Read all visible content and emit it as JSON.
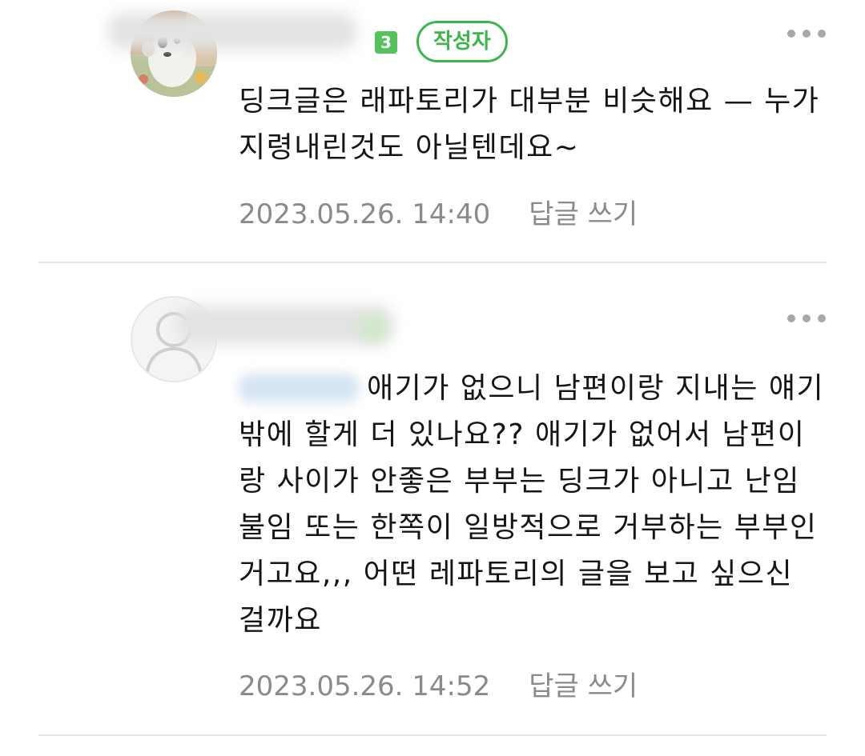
{
  "comments": [
    {
      "level_badge": "3",
      "author_tag": "작성자",
      "text": "딩크글은 래파토리가 대부분 비슷해요 — 누가 지령내린것도 아닐텐데요~",
      "datetime": "2023.05.26. 14:40",
      "reply_label": "답글 쓰기",
      "more_icon": "more-horizontal-icon"
    },
    {
      "level_badge": "",
      "text": "애기가 없으니 남편이랑 지내는 얘기밖에 할게 더 있나요?? 애기가 없어서 남편이랑 사이가 안좋은 부부는 딩크가 아니고 난임불임 또는 한쪽이 일방적으로 거부하는 부부인거고요,,, 어떤 레파토리의 글을 보고 싶으신 걸까요",
      "datetime": "2023.05.26. 14:52",
      "reply_label": "답글 쓰기",
      "more_icon": "more-horizontal-icon"
    }
  ],
  "colors": {
    "accent_green": "#3cb54a",
    "mention_blue": "#2f6db8",
    "meta_gray": "#8a8a8a",
    "divider": "#e4e4e4"
  }
}
